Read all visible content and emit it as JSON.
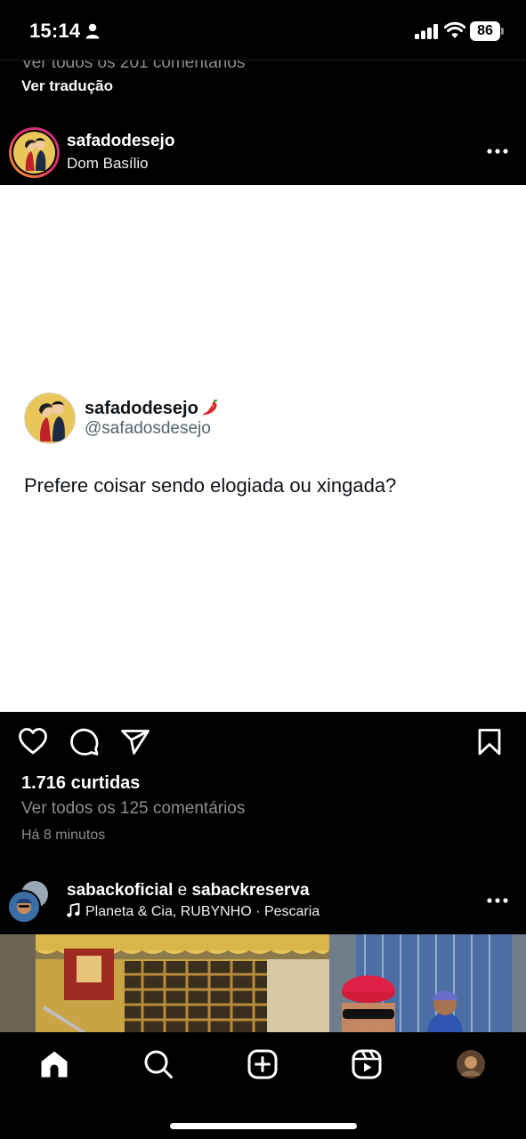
{
  "status_bar": {
    "time": "15:14",
    "battery": "86",
    "icons": [
      "person-icon",
      "signal-icon",
      "wifi-icon",
      "battery-icon"
    ]
  },
  "previous_post": {
    "comments_link": "Ver todos os 201 comentários",
    "see_translation": "Ver tradução"
  },
  "post": {
    "username": "safadodesejo",
    "subtitle": "Dom Basílio",
    "tweet": {
      "name": "safadodesejo",
      "emoji": "🌶",
      "handle": "@safadosdesejo",
      "text": "Prefere coisar sendo elogiada ou xingada?"
    },
    "likes": "1.716 curtidas",
    "view_comments": "Ver todos os 125 comentários",
    "time_ago": "Há 8 minutos",
    "action_icons": [
      "heart-icon",
      "comment-icon",
      "share-icon",
      "bookmark-icon"
    ]
  },
  "next_post": {
    "user1": "sabackoficial",
    "connector": "e",
    "user2": "sabackreserva",
    "music": "Planeta & Cia, RUBYNHO · Pescaria"
  },
  "tab_bar": {
    "icons": [
      "home-icon",
      "search-icon",
      "create-icon",
      "reels-icon",
      "profile-avatar"
    ]
  },
  "colors": {
    "background": "#000000",
    "text": "#ffffff",
    "muted": "#8e8e8e",
    "tweet_text": "#0f1419",
    "tweet_handle": "#536471",
    "story_ring": "#e1306c"
  }
}
